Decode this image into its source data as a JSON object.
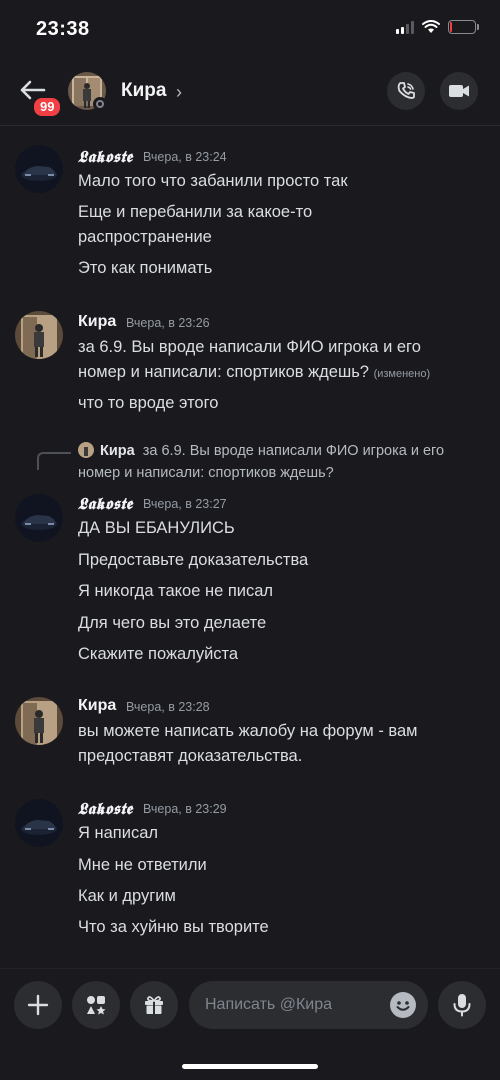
{
  "status_bar": {
    "time": "23:38",
    "battery_level": 0.1,
    "battery_color": "#f23f43"
  },
  "header": {
    "unread_badge": "99",
    "name": "Кира",
    "chevron": "›"
  },
  "messages": [
    {
      "author": "𝕷𝖆𝖐𝖔𝖘𝖙𝖊",
      "time": "Вчера, в 23:24",
      "lines": [
        "Мало того что забанили просто так",
        "Еще и перебанили за какое-то",
        "распространение",
        "Это как понимать"
      ]
    },
    {
      "author": "Кира",
      "time": "Вчера, в 23:26",
      "lines": [
        "за 6.9. Вы вроде написали ФИО игрока и его",
        "номер и написали: спортиков ждешь?",
        "что то вроде этого"
      ],
      "edited": "(изменено)"
    },
    {
      "reply": {
        "author": "Кира",
        "line1": "за 6.9. Вы вроде написали ФИО игрока и его",
        "line2": "номер и написали: спортиков ждешь?"
      },
      "author": "𝕷𝖆𝖐𝖔𝖘𝖙𝖊",
      "time": "Вчера, в 23:27",
      "lines": [
        "ДА ВЫ ЕБАНУЛИСЬ",
        "Предоставьте доказательства",
        "Я никогда такое не писал",
        "Для чего вы это делаете",
        "Скажите пожалуйста"
      ]
    },
    {
      "author": "Кира",
      "time": "Вчера, в 23:28",
      "lines": [
        "вы можете написать жалобу на форум - вам",
        "предоставят доказательства."
      ]
    },
    {
      "author": "𝕷𝖆𝖐𝖔𝖘𝖙𝖊",
      "time": "Вчера, в 23:29",
      "lines": [
        "Я написал",
        "Мне не ответили",
        "Как и другим",
        "Что за хуйню вы творите"
      ]
    }
  ],
  "composer": {
    "placeholder": "Написать @Кира"
  },
  "colors": {
    "background": "#1a1a1e",
    "button": "#2b2d31",
    "text": "#dbdee1",
    "muted": "#949ba4"
  }
}
